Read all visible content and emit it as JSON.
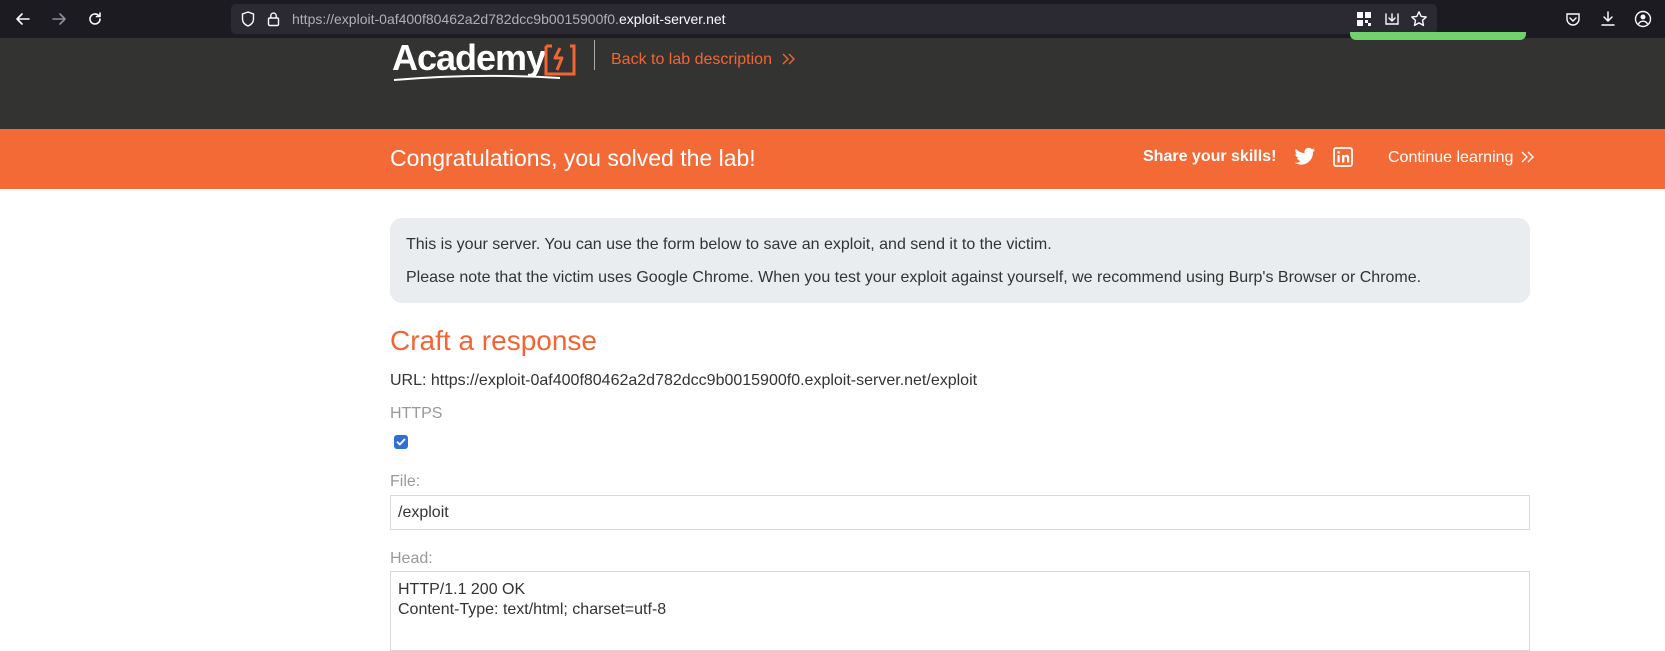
{
  "browser": {
    "url_prefix": "https://exploit-0af400f80462a2d782dcc9b0015900f0.",
    "url_domain": "exploit-server.net"
  },
  "header": {
    "logo_text": "Academy",
    "back_link": "Back to lab description"
  },
  "banner": {
    "congrats": "Congratulations, you solved the lab!",
    "share_label": "Share your skills!",
    "continue_label": "Continue learning"
  },
  "info": {
    "line1": "This is your server. You can use the form below to save an exploit, and send it to the victim.",
    "line2": "Please note that the victim uses Google Chrome. When you test your exploit against yourself, we recommend using Burp's Browser or Chrome."
  },
  "form": {
    "title": "Craft a response",
    "url_line": "URL: https://exploit-0af400f80462a2d782dcc9b0015900f0.exploit-server.net/exploit",
    "https_label": "HTTPS",
    "https_checked": true,
    "file_label": "File:",
    "file_value": "/exploit",
    "head_label": "Head:",
    "head_lines": [
      "HTTP/1.1 200 OK",
      "Content-Type: text/html; charset=utf-8"
    ]
  },
  "colors": {
    "accent": "#f26532",
    "banner": "#f46a37",
    "header_bg": "#333332",
    "info_bg": "#e9edf0"
  }
}
